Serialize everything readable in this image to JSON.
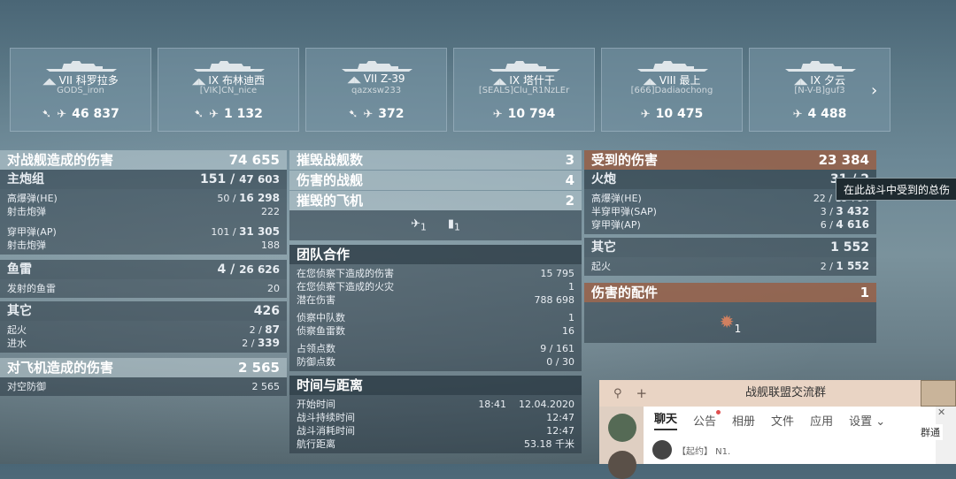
{
  "ships": [
    {
      "tier": "VII",
      "class": "◢◣",
      "name": "科罗拉多",
      "player": "GODS_iron",
      "icons": [
        "torpedo",
        "plane"
      ],
      "damage": "46 837"
    },
    {
      "tier": "IX",
      "class": "◢◣",
      "name": "布林迪西",
      "player": "[VIK]CN_nice",
      "icons": [
        "torpedo",
        "plane"
      ],
      "damage": "1 132"
    },
    {
      "tier": "VII",
      "class": "◢◣",
      "name": "Z-39",
      "player": "qazxsw233",
      "icons": [
        "torpedo",
        "plane"
      ],
      "damage": "372"
    },
    {
      "tier": "IX",
      "class": "◢◣",
      "name": "塔什干",
      "player": "[SEALS]Clu_R1NzLEr",
      "icons": [
        "plane"
      ],
      "damage": "10 794"
    },
    {
      "tier": "VIII",
      "class": "◢◣",
      "name": "最上",
      "player": "[666]Dadiaochong",
      "icons": [
        "plane"
      ],
      "damage": "10 475"
    },
    {
      "tier": "IX",
      "class": "◢◣",
      "name": "夕云",
      "player": "[N-V-B]guf3",
      "icons": [
        "plane"
      ],
      "damage": "4 488"
    }
  ],
  "left": {
    "ship_damage": {
      "label": "对战舰造成的伤害",
      "value": "74 655"
    },
    "main_battery": {
      "label": "主炮组",
      "value_a": "151 / ",
      "value_b": "47 603"
    },
    "he": {
      "label": "高爆弹(HE)",
      "value_a": "50 / ",
      "value_b": "16 298"
    },
    "he_shots": {
      "label": "射击炮弹",
      "value": "222"
    },
    "ap": {
      "label": "穿甲弹(AP)",
      "value_a": "101 / ",
      "value_b": "31 305"
    },
    "ap_shots": {
      "label": "射击炮弹",
      "value": "188"
    },
    "torpedo": {
      "label": "鱼雷",
      "value_a": "4 / ",
      "value_b": "26 626"
    },
    "torp_fired": {
      "label": "发射的鱼雷",
      "value": "20"
    },
    "other": {
      "label": "其它",
      "value": "426"
    },
    "fire": {
      "label": "起火",
      "value_a": "2 / ",
      "value_b": "87"
    },
    "flood": {
      "label": "进水",
      "value_a": "2 / ",
      "value_b": "339"
    },
    "plane_damage": {
      "label": "对飞机造成的伤害",
      "value": "2 565"
    },
    "aa": {
      "label": "对空防御",
      "value": "2 565"
    }
  },
  "middle": {
    "destroyed_ships": {
      "label": "摧毁战舰数",
      "value": "3"
    },
    "damaged_ships": {
      "label": "伤害的战舰",
      "value": "4"
    },
    "destroyed_planes": {
      "label": "摧毁的飞机",
      "value": "2"
    },
    "plane_icons": [
      {
        "value": "1"
      },
      {
        "value": "1"
      }
    ],
    "teamwork": {
      "label": "团队合作"
    },
    "spot_damage": {
      "label": "在您侦察下造成的伤害",
      "value": "15 795"
    },
    "spot_fire": {
      "label": "在您侦察下造成的火灾",
      "value": "1"
    },
    "potential": {
      "label": "潜在伤害",
      "value": "788 698"
    },
    "spot_squad": {
      "label": "侦察中队数",
      "value": "1"
    },
    "spot_torp": {
      "label": "侦察鱼雷数",
      "value": "16"
    },
    "capture": {
      "label": "占领点数",
      "value": "9 / 161"
    },
    "defense": {
      "label": "防御点数",
      "value": "0 / 30"
    },
    "time_header": {
      "label": "时间与距离"
    },
    "start_time": {
      "label": "开始时间",
      "time": "18:41",
      "date": "12.04.2020"
    },
    "duration": {
      "label": "战斗持续时间",
      "value": "12:47"
    },
    "time_spent": {
      "label": "战斗消耗时间",
      "value": "12:47"
    },
    "distance": {
      "label": "航行距离",
      "value": "53.18  千米"
    }
  },
  "right": {
    "received": {
      "label": "受到的伤害",
      "value": "23 384"
    },
    "main": {
      "label": "火炮",
      "value": "31 / 2"
    },
    "he": {
      "label": "高爆弹(HE)",
      "value": "22 / 15 784"
    },
    "sap": {
      "label": "半穿甲弹(SAP)",
      "value_a": "3 / ",
      "value_b": "3 432"
    },
    "ap": {
      "label": "穿甲弹(AP)",
      "value_a": "6 / ",
      "value_b": "4 616"
    },
    "other": {
      "label": "其它",
      "value": "1 552"
    },
    "fire": {
      "label": "起火",
      "value_a": "2 / ",
      "value_b": "1 552"
    },
    "modules": {
      "label": "伤害的配件",
      "value": "1"
    },
    "module_icon_value": "1",
    "tooltip": "在此战斗中受到的总伤"
  },
  "chat": {
    "title": "战舰联盟交流群",
    "tabs": [
      "聊天",
      "公告",
      "相册",
      "文件",
      "应用",
      "设置"
    ],
    "active_tab": "聊天",
    "message_preview": "【起约】 N1.",
    "right_label": "群通"
  },
  "colors": {
    "header_brown": "#965f46",
    "header_dark": "#28373f",
    "accent_white": "#ffffff"
  }
}
